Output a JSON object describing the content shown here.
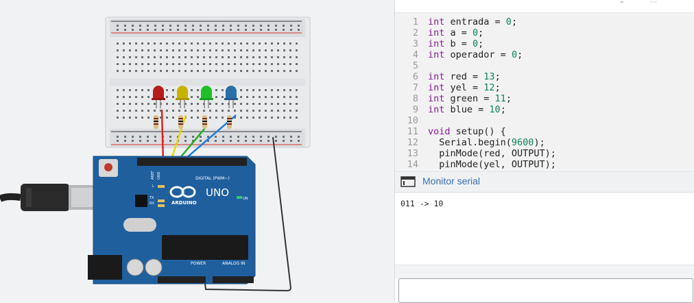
{
  "code": {
    "lines": [
      {
        "n": "1",
        "tokens": [
          [
            "kw",
            "int"
          ],
          [
            "t",
            " entrada = "
          ],
          [
            "num",
            "0"
          ],
          [
            "t",
            ";"
          ]
        ]
      },
      {
        "n": "2",
        "tokens": [
          [
            "kw",
            "int"
          ],
          [
            "t",
            " a = "
          ],
          [
            "num",
            "0"
          ],
          [
            "t",
            ";"
          ]
        ]
      },
      {
        "n": "3",
        "tokens": [
          [
            "kw",
            "int"
          ],
          [
            "t",
            " b = "
          ],
          [
            "num",
            "0"
          ],
          [
            "t",
            ";"
          ]
        ]
      },
      {
        "n": "4",
        "tokens": [
          [
            "kw",
            "int"
          ],
          [
            "t",
            " operador = "
          ],
          [
            "num",
            "0"
          ],
          [
            "t",
            ";"
          ]
        ]
      },
      {
        "n": "5",
        "tokens": []
      },
      {
        "n": "6",
        "tokens": [
          [
            "kw",
            "int"
          ],
          [
            "t",
            " red = "
          ],
          [
            "num",
            "13"
          ],
          [
            "t",
            ";"
          ]
        ]
      },
      {
        "n": "7",
        "tokens": [
          [
            "kw",
            "int"
          ],
          [
            "t",
            " yel = "
          ],
          [
            "num",
            "12"
          ],
          [
            "t",
            ";"
          ]
        ]
      },
      {
        "n": "8",
        "tokens": [
          [
            "kw",
            "int"
          ],
          [
            "t",
            " green = "
          ],
          [
            "num",
            "11"
          ],
          [
            "t",
            ";"
          ]
        ]
      },
      {
        "n": "9",
        "tokens": [
          [
            "kw",
            "int"
          ],
          [
            "t",
            " blue = "
          ],
          [
            "num",
            "10"
          ],
          [
            "t",
            ";"
          ]
        ]
      },
      {
        "n": "10",
        "tokens": []
      },
      {
        "n": "11",
        "tokens": [
          [
            "kw",
            "void"
          ],
          [
            "t",
            " setup() {"
          ]
        ]
      },
      {
        "n": "12",
        "tokens": [
          [
            "t",
            "  Serial.begin("
          ],
          [
            "num",
            "9600"
          ],
          [
            "t",
            ");"
          ]
        ]
      },
      {
        "n": "13",
        "tokens": [
          [
            "t",
            "  pinMode(red, OUTPUT);"
          ]
        ]
      },
      {
        "n": "14",
        "tokens": [
          [
            "t",
            "  pinMode(yel, OUTPUT);"
          ]
        ]
      }
    ]
  },
  "serial": {
    "title": "Monitor serial",
    "output": "011 -> 10",
    "input_value": ""
  },
  "board": {
    "logo": "UNO",
    "brand": "ARDUINO",
    "digital_label": "DIGITAL (PWM~)",
    "power_label": "POWER",
    "analog_label": "ANALOG IN",
    "on_label": "ON",
    "tx_label": "TX",
    "rx_label": "RX",
    "l_label": "L",
    "aref_label": "AREF",
    "gnd_label": "GND"
  },
  "leds": [
    {
      "color": "#b71c1c",
      "name": "red"
    },
    {
      "color": "#c8b400",
      "name": "yellow"
    },
    {
      "color": "#1fbf2a",
      "name": "green"
    },
    {
      "color": "#2b6fa8",
      "name": "blue"
    }
  ],
  "wire_colors": {
    "red": "#e0201e",
    "yellow": "#e8d800",
    "green": "#20b020",
    "blue": "#2080d8",
    "black": "#333333"
  },
  "toolbar": {
    "icon1": "debug-icon",
    "icon2": "more-icon"
  }
}
